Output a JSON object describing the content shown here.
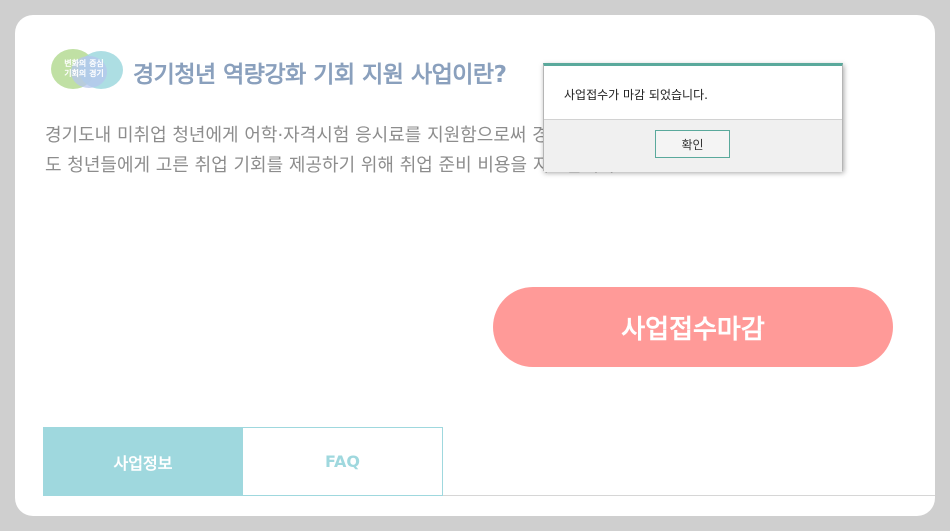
{
  "logo": {
    "line1": "변화의 중심",
    "line2": "기회의 경기"
  },
  "header": {
    "title": "경기청년 역량강화 기회 지원 사업이란?"
  },
  "description": {
    "line1": "경기도내 미취업 청년에게 어학·자격시험 응시료를 지원함으로써 경제적 부담을 덜어주고, 경기",
    "line2": "도 청년들에게 고른 취업 기회를 제공하기 위해 취업 준비 비용을 지원합니다"
  },
  "main": {
    "closed_button_label": "사업접수마감"
  },
  "tabs": [
    {
      "label": "사업정보",
      "active": true
    },
    {
      "label": "FAQ",
      "active": false
    }
  ],
  "dialog": {
    "message": "사업접수가 마감 되었습니다.",
    "ok_label": "확인"
  },
  "colors": {
    "accent": "#9fd8de",
    "closed_button": "#ff9a98",
    "title": "#8aa0bd",
    "dialog_accent": "#5aa99c"
  }
}
